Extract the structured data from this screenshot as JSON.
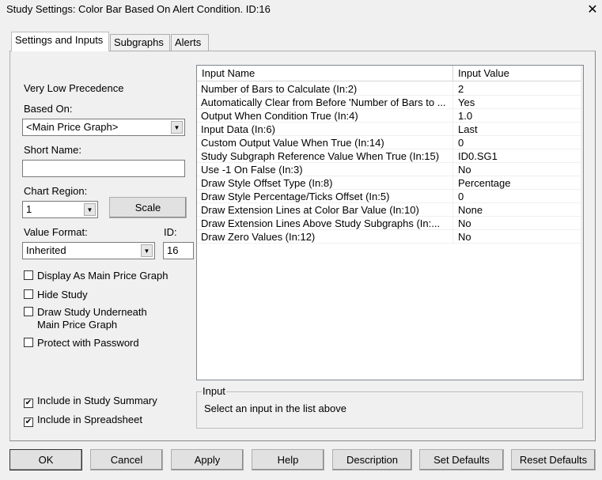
{
  "window": {
    "title": "Study Settings: Color Bar Based On Alert Condition. ID:16",
    "close": "✕"
  },
  "tabs": [
    "Settings and Inputs",
    "Subgraphs",
    "Alerts"
  ],
  "left": {
    "precedence": "Very Low Precedence",
    "based_on_label": "Based On:",
    "based_on_value": "<Main Price Graph>",
    "short_name_label": "Short Name:",
    "short_name_value": "",
    "chart_region_label": "Chart Region:",
    "chart_region_value": "1",
    "scale_button": "Scale",
    "value_format_label": "Value Format:",
    "value_format_value": "Inherited",
    "id_label": "ID:",
    "id_value": "16",
    "checkboxes": [
      {
        "label": "Display As Main Price Graph",
        "checked": false
      },
      {
        "label": "Hide Study",
        "checked": false
      },
      {
        "label": "Draw Study Underneath",
        "label2": "Main Price Graph",
        "checked": false
      },
      {
        "label": "Protect with Password",
        "checked": false
      },
      {
        "label": "Include in Study Summary",
        "checked": true
      },
      {
        "label": "Include in Spreadsheet",
        "checked": true
      }
    ],
    "check_mark": "✔"
  },
  "table": {
    "headers": [
      "Input Name",
      "Input Value"
    ],
    "rows": [
      {
        "name": "Number of Bars to Calculate   (In:2)",
        "value": "2"
      },
      {
        "name": "Automatically Clear from Before 'Number of Bars to ...",
        "value": "Yes"
      },
      {
        "name": "Output When Condition True   (In:4)",
        "value": "1.0"
      },
      {
        "name": "Input Data   (In:6)",
        "value": "Last"
      },
      {
        "name": "Custom Output Value When True   (In:14)",
        "value": "0"
      },
      {
        "name": "Study Subgraph Reference Value When True   (In:15)",
        "value": "ID0.SG1"
      },
      {
        "name": "Use -1 On False   (In:3)",
        "value": "No"
      },
      {
        "name": "Draw Style Offset Type   (In:8)",
        "value": "Percentage"
      },
      {
        "name": "Draw Style Percentage/Ticks Offset   (In:5)",
        "value": "0"
      },
      {
        "name": "Draw Extension Lines at Color Bar Value   (In:10)",
        "value": "None"
      },
      {
        "name": "Draw Extension Lines Above Study Subgraphs   (In:...",
        "value": "No"
      },
      {
        "name": "Draw Zero Values   (In:12)",
        "value": "No"
      }
    ]
  },
  "input_group": {
    "label": "Input",
    "text": "Select an input in the list above"
  },
  "buttons": [
    "OK",
    "Cancel",
    "Apply",
    "Help",
    "Description",
    "Set Defaults",
    "Reset Defaults"
  ]
}
